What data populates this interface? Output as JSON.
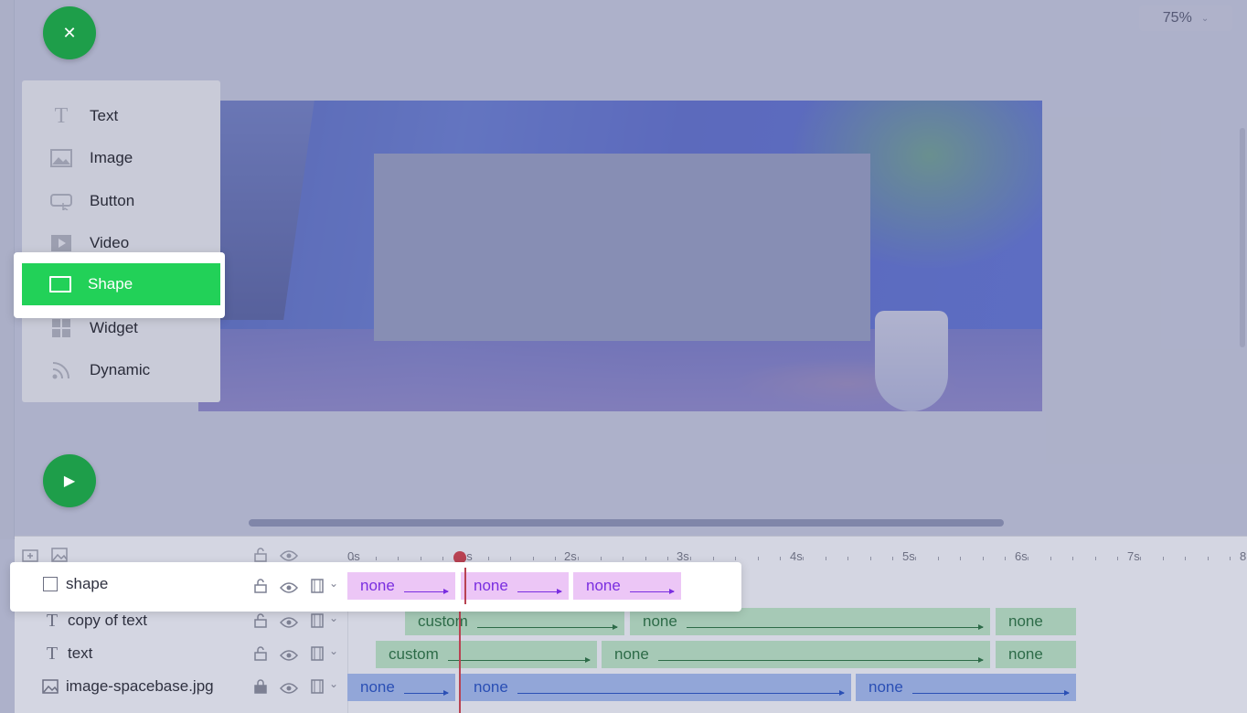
{
  "zoom": {
    "value": "75%"
  },
  "menu": {
    "items": [
      {
        "label": "Text",
        "icon": "text-icon"
      },
      {
        "label": "Image",
        "icon": "image-icon"
      },
      {
        "label": "Button",
        "icon": "button-icon"
      },
      {
        "label": "Video",
        "icon": "video-icon"
      },
      {
        "label": "Shape",
        "icon": "shape-icon",
        "active": true
      },
      {
        "label": "Widget",
        "icon": "widget-icon"
      },
      {
        "label": "Dynamic",
        "icon": "dynamic-icon"
      }
    ]
  },
  "ruler": {
    "labels": [
      "0s",
      "1s",
      "2s",
      "3s",
      "4s",
      "5s",
      "6s",
      "7s",
      "8"
    ]
  },
  "layers": [
    {
      "name": "shape",
      "icon": "shape-icon",
      "segments": [
        {
          "label": "none"
        },
        {
          "label": "none"
        },
        {
          "label": "none"
        }
      ]
    },
    {
      "name": "copy of text",
      "icon": "text-icon",
      "segments": [
        {
          "label": "custom"
        },
        {
          "label": "none"
        },
        {
          "label": "none"
        }
      ]
    },
    {
      "name": "text",
      "icon": "text-icon",
      "segments": [
        {
          "label": "custom"
        },
        {
          "label": "none"
        },
        {
          "label": "none"
        }
      ]
    },
    {
      "name": "image-spacebase.jpg",
      "icon": "image-icon",
      "segments": [
        {
          "label": "none"
        },
        {
          "label": "none"
        },
        {
          "label": "none"
        }
      ]
    }
  ],
  "colors": {
    "accent_green": "#22d158",
    "fab_green": "#1e9e4a",
    "playhead": "#b84252"
  }
}
